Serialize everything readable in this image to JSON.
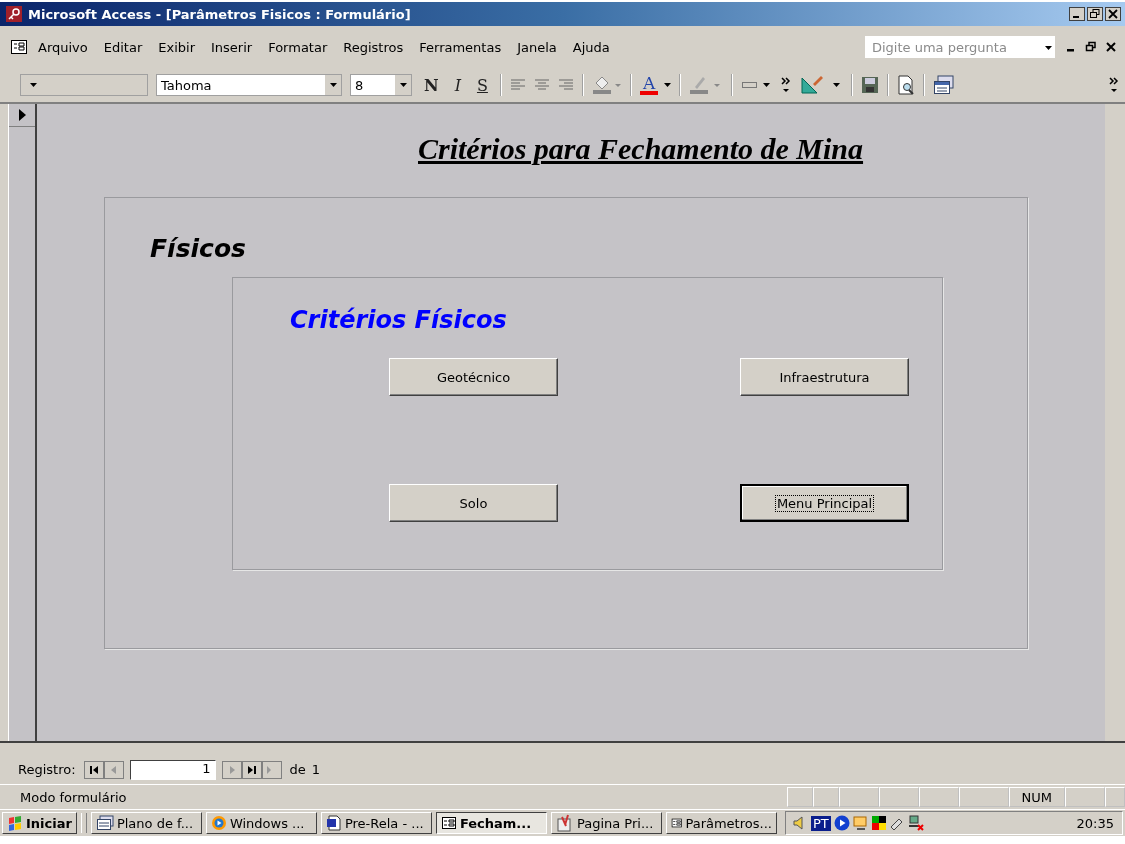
{
  "window": {
    "title": "Microsoft Access - [Parâmetros Fisicos : Formulário]"
  },
  "menu": [
    {
      "label": "Arquivo"
    },
    {
      "label": "Editar"
    },
    {
      "label": "Exibir"
    },
    {
      "label": "Inserir"
    },
    {
      "label": "Formatar"
    },
    {
      "label": "Registros"
    },
    {
      "label": "Ferramentas"
    },
    {
      "label": "Janela"
    },
    {
      "label": "Ajuda"
    }
  ],
  "help_box": {
    "placeholder": "Digite uma pergunta"
  },
  "toolbar": {
    "font": "Tahoma",
    "size": "8",
    "bold": "N",
    "italic": "I",
    "underline": "S",
    "font_color": "A"
  },
  "form": {
    "title": "Critérios para Fechamento de Mina",
    "section": "Físicos",
    "group": "Critérios Físicos",
    "buttons": [
      {
        "label": "Geotécnico",
        "focused": false
      },
      {
        "label": "Infraestrutura",
        "focused": false
      },
      {
        "label": "Solo",
        "focused": false
      },
      {
        "label": "Menu Principal",
        "focused": true
      }
    ]
  },
  "record_nav": {
    "label": "Registro:",
    "value": "1",
    "of": "de",
    "total": "1"
  },
  "status_bar": {
    "mode": "Modo formulário",
    "indicator": "NUM"
  },
  "taskbar": {
    "start": "Iniciar",
    "tasks": [
      {
        "label": "Plano de f...",
        "selected": false
      },
      {
        "label": "Windows ...",
        "selected": false
      },
      {
        "label": "Pre-Rela - ...",
        "selected": false
      },
      {
        "label": "Fecham...",
        "selected": true
      },
      {
        "label": "Pagina Pri...",
        "selected": false
      },
      {
        "label": "Parâmetros...",
        "selected": false
      }
    ],
    "language": "PT",
    "clock": "20:35"
  }
}
